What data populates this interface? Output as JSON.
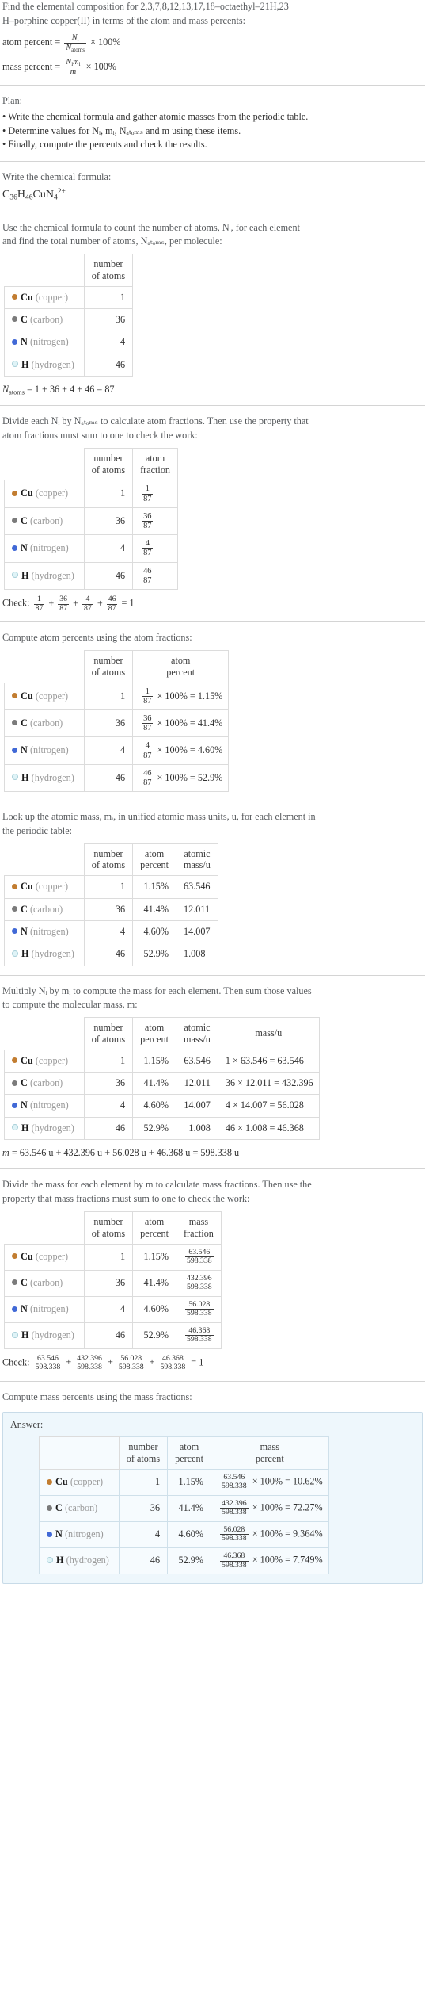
{
  "header": {
    "intro_line1": "Find the elemental composition for 2,3,7,8,12,13,17,18–octaethyl–21H,23",
    "intro_line2": "H–porphine copper(II) in terms of the atom and mass percents:",
    "atom_percent_label": "atom percent",
    "mass_percent_label": "mass percent",
    "eq_times": "× 100%",
    "frac1_num": "N",
    "frac1_num_sub": "i",
    "frac1_den": "N",
    "frac1_den_sub": "atoms",
    "frac2_num": "N",
    "frac2_num_sub": "i",
    "frac2_num2": "m",
    "frac2_num2_sub": "i",
    "frac2_den": "m"
  },
  "plan": {
    "title": "Plan:",
    "bullets": [
      "• Write the chemical formula and gather atomic masses from the periodic table.",
      "• Determine values for Nᵢ, mᵢ, Nₐₜₒₘₛ and m using these items.",
      "• Finally, compute the percents and check the results."
    ]
  },
  "formula_section": {
    "prompt": "Write the chemical formula:",
    "formula_parts": [
      {
        "sym": "C",
        "sub": "36"
      },
      {
        "sym": "H",
        "sub": "46"
      },
      {
        "sym": "Cu",
        "sub": ""
      },
      {
        "sym": "N",
        "sub": "4",
        "sup": "2+"
      }
    ],
    "formula_plain": "C36H46CuN4 2+"
  },
  "elements": [
    {
      "symbol": "Cu",
      "name": "(copper)",
      "color": "#c27d31",
      "filled": true,
      "count": 1,
      "fraction_num": "1",
      "fraction_den": "87",
      "atom_percent": "1.15%",
      "atom_pct_eq": "× 100% = 1.15%",
      "atomic_mass": "63.546",
      "mass_eq": "1 × 63.546 = 63.546",
      "mass_num": "63.546",
      "mass_den": "598.338",
      "mass_pct_eq": "× 100% = 10.62%",
      "mass_percent": "10.62%"
    },
    {
      "symbol": "C",
      "name": "(carbon)",
      "color": "#7b7b7b",
      "filled": true,
      "count": 36,
      "fraction_num": "36",
      "fraction_den": "87",
      "atom_percent": "41.4%",
      "atom_pct_eq": "× 100% = 41.4%",
      "atomic_mass": "12.011",
      "mass_eq": "36 × 12.011 = 432.396",
      "mass_num": "432.396",
      "mass_den": "598.338",
      "mass_pct_eq": "× 100% = 72.27%",
      "mass_percent": "72.27%"
    },
    {
      "symbol": "N",
      "name": "(nitrogen)",
      "color": "#4169d6",
      "filled": true,
      "count": 4,
      "fraction_num": "4",
      "fraction_den": "87",
      "atom_percent": "4.60%",
      "atom_pct_eq": "× 100% = 4.60%",
      "atomic_mass": "14.007",
      "mass_eq": "4 × 14.007 = 56.028",
      "mass_num": "56.028",
      "mass_den": "598.338",
      "mass_pct_eq": "× 100% = 9.364%",
      "mass_percent": "9.364%"
    },
    {
      "symbol": "H",
      "name": "(hydrogen)",
      "color": "#dff3f7",
      "filled": false,
      "count": 46,
      "fraction_num": "46",
      "fraction_den": "87",
      "atom_percent": "52.9%",
      "atom_pct_eq": "× 100% = 52.9%",
      "atomic_mass": "1.008",
      "mass_eq": "46 × 1.008 = 46.368",
      "mass_num": "46.368",
      "mass_den": "598.338",
      "mass_pct_eq": "× 100% = 7.749%",
      "mass_percent": "7.749%"
    }
  ],
  "headers": {
    "number_of_atoms_l1": "number",
    "number_of_atoms_l2": "of atoms",
    "atom_fraction_l1": "atom",
    "atom_fraction_l2": "fraction",
    "atom_percent_l1": "atom",
    "atom_percent_l2": "percent",
    "atomic_mass_l1": "atomic",
    "atomic_mass_l2": "mass/u",
    "mass_l1": "mass/u",
    "mass_fraction_l1": "mass",
    "mass_fraction_l2": "fraction",
    "mass_percent_l1": "mass",
    "mass_percent_l2": "percent"
  },
  "count_section": {
    "text_l1": "Use the chemical formula to count the number of atoms, Nᵢ, for each element",
    "text_l2": "and find the total number of atoms, Nₐₜₒₘₛ, per molecule:",
    "total_eq": "= 1 + 36 + 4 + 46 = 87",
    "total_label": "N",
    "total_sub": "atoms"
  },
  "fraction_section": {
    "text_l1": "Divide each Nᵢ by Nₐₜₒₘₛ to calculate atom fractions. Then use the property that",
    "text_l2": "atom fractions must sum to one to check the work:",
    "check_label": "Check:",
    "check_result": "= 1"
  },
  "atom_percent_section": {
    "text": "Compute atom percents using the atom fractions:"
  },
  "atomic_mass_section": {
    "text_l1": "Look up the atomic mass, mᵢ, in unified atomic mass units, u, for each element in",
    "text_l2": "the periodic table:"
  },
  "mass_section": {
    "text_l1": "Multiply Nᵢ by mᵢ to compute the mass for each element. Then sum those values",
    "text_l2": "to compute the molecular mass, m:",
    "sum_eq": "= 63.546 u + 432.396 u + 56.028 u + 46.368 u = 598.338 u",
    "sum_label": "m"
  },
  "mass_fraction_section": {
    "text_l1": "Divide the mass for each element by m to calculate mass fractions. Then use the",
    "text_l2": "property that mass fractions must sum to one to check the work:",
    "check_label": "Check:",
    "check_result": "= 1"
  },
  "mass_percent_section": {
    "text": "Compute mass percents using the mass fractions:"
  },
  "answer": {
    "label": "Answer:"
  }
}
